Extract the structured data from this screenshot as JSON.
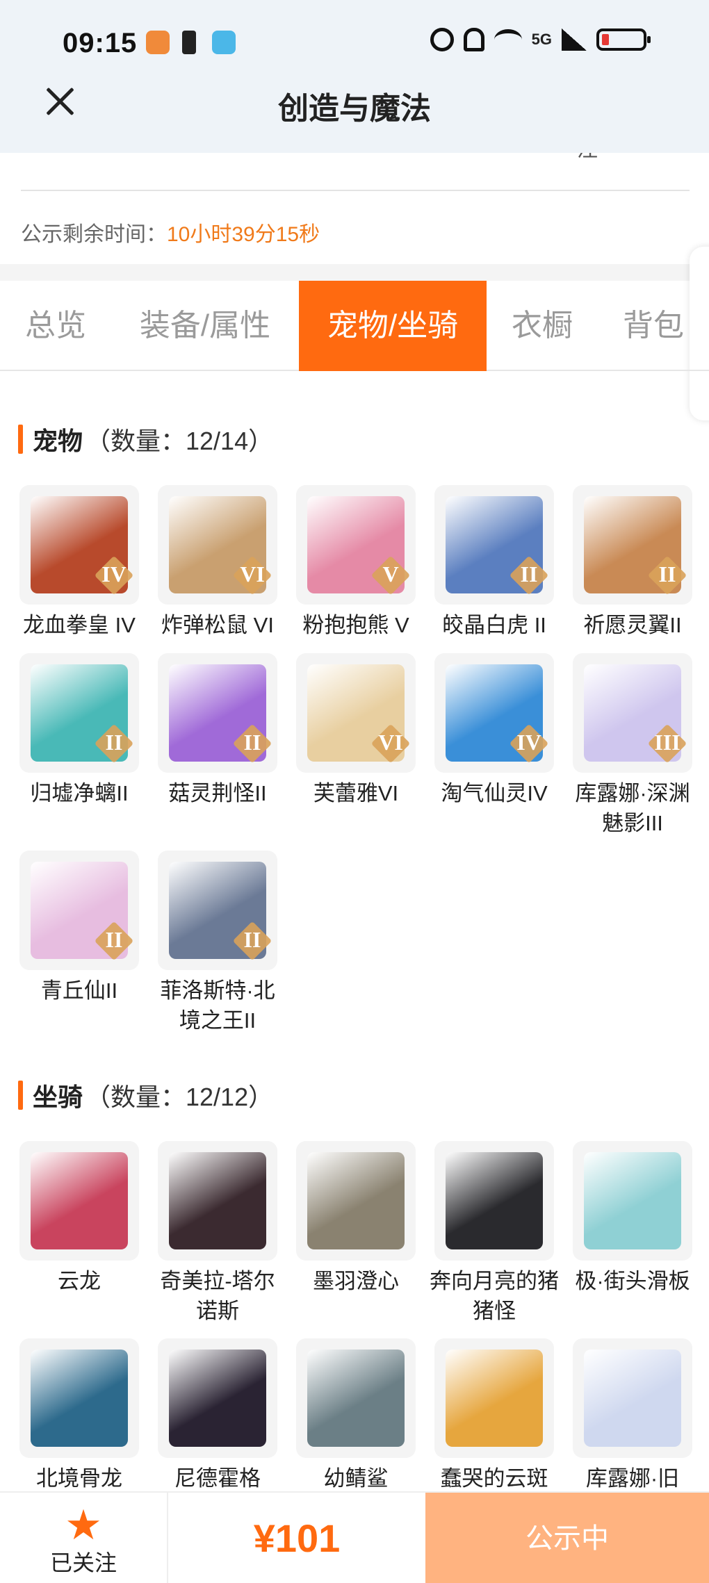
{
  "status_bar": {
    "time": "09:15",
    "network": "5G"
  },
  "header": {
    "title": "创造与魔法"
  },
  "cut_text": {
    "left": "…",
    "right": "注"
  },
  "notice": {
    "label": "公示剩余时间：",
    "value": "10小时39分15秒"
  },
  "tabs": [
    {
      "label": "总览",
      "active": false
    },
    {
      "label": "装备/属性",
      "active": false
    },
    {
      "label": "宠物/坐骑",
      "active": true
    },
    {
      "label": "衣橱",
      "active": false
    },
    {
      "label": "背包",
      "active": false
    }
  ],
  "pets": {
    "title": "宠物",
    "count": "（数量：12/14）",
    "items": [
      {
        "name": "龙血拳皇 IV",
        "rank": "IV",
        "color": "#b84a2c"
      },
      {
        "name": "炸弹松鼠 VI",
        "rank": "VI",
        "color": "#c9a070"
      },
      {
        "name": "粉抱抱熊 V",
        "rank": "V",
        "color": "#e58aa6"
      },
      {
        "name": "皎晶白虎 II",
        "rank": "II",
        "color": "#5b7fc0"
      },
      {
        "name": "祈愿灵翼II",
        "rank": "II",
        "color": "#c98a55"
      },
      {
        "name": "归墟净螭II",
        "rank": "II",
        "color": "#49b9b7"
      },
      {
        "name": "菇灵荆怪II",
        "rank": "II",
        "color": "#a06ad8"
      },
      {
        "name": "芙蕾雅VI",
        "rank": "VI",
        "color": "#e8cfa0"
      },
      {
        "name": "淘气仙灵IV",
        "rank": "IV",
        "color": "#3a8fd8"
      },
      {
        "name": "库露娜·深渊魅影III",
        "rank": "III",
        "color": "#cfc6ee"
      },
      {
        "name": "青丘仙II",
        "rank": "II",
        "color": "#e7bde0"
      },
      {
        "name": "菲洛斯特·北境之王II",
        "rank": "II",
        "color": "#6b7a96"
      }
    ]
  },
  "mounts": {
    "title": "坐骑",
    "count": "（数量：12/12）",
    "items": [
      {
        "name": "云龙",
        "color": "#c9445e"
      },
      {
        "name": "奇美拉-塔尔诺斯",
        "color": "#3b2a30"
      },
      {
        "name": "墨羽澄心",
        "color": "#8a8270"
      },
      {
        "name": "奔向月亮的猪猪怪",
        "color": "#2a2a2e"
      },
      {
        "name": "极·街头滑板",
        "color": "#8fd0d4"
      },
      {
        "name": "北境骨龙",
        "color": "#2d6a8c"
      },
      {
        "name": "尼德霍格",
        "color": "#2a2333"
      },
      {
        "name": "幼鲭鲨",
        "color": "#6b7f86"
      },
      {
        "name": "蠢哭的云斑",
        "color": "#e6a63e"
      },
      {
        "name": "库露娜·旧",
        "color": "#cfd8ef"
      }
    ]
  },
  "bottom": {
    "follow_label": "已关注",
    "price": "¥101",
    "status": "公示中"
  }
}
